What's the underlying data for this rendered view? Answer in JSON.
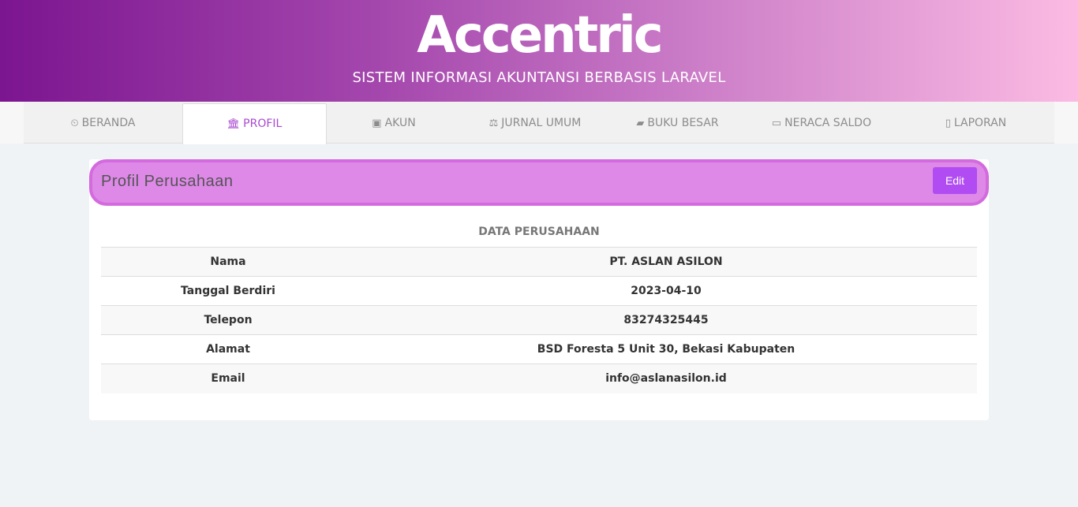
{
  "banner": {
    "brand": "Accentric",
    "tagline": "SISTEM INFORMASI AKUNTANSI BERBASIS LARAVEL"
  },
  "nav": {
    "items": [
      {
        "icon": "dashboard-icon",
        "glyph": "⏲",
        "label": "BERANDA",
        "active": false
      },
      {
        "icon": "bank-icon",
        "glyph": "🏛",
        "label": "PROFIL",
        "active": true
      },
      {
        "icon": "contact-book-icon",
        "glyph": "▣",
        "label": "AKUN",
        "active": false
      },
      {
        "icon": "scale-icon",
        "glyph": "⚖",
        "label": "JURNAL UMUM",
        "active": false
      },
      {
        "icon": "book-icon",
        "glyph": "▰",
        "label": "BUKU BESAR",
        "active": false
      },
      {
        "icon": "money-icon",
        "glyph": "▭",
        "label": "NERACA SALDO",
        "active": false
      },
      {
        "icon": "pdf-file-icon",
        "glyph": "▯",
        "label": "LAPORAN",
        "active": false
      }
    ]
  },
  "card": {
    "title": "Profil Perusahaan",
    "edit_label": "Edit"
  },
  "table": {
    "caption": "DATA PERUSAHAAN",
    "rows": [
      {
        "label": "Nama",
        "value": "PT. ASLAN ASILON"
      },
      {
        "label": "Tanggal Berdiri",
        "value": "2023-04-10"
      },
      {
        "label": "Telepon",
        "value": "83274325445"
      },
      {
        "label": "Alamat",
        "value": "BSD Foresta 5 Unit 30, Bekasi Kabupaten"
      },
      {
        "label": "Email",
        "value": "info@aslanasilon.id"
      }
    ]
  },
  "colors": {
    "accent": "#b14cf2",
    "header_band": "#de89e8",
    "active_tab_text": "#a84ad0"
  }
}
